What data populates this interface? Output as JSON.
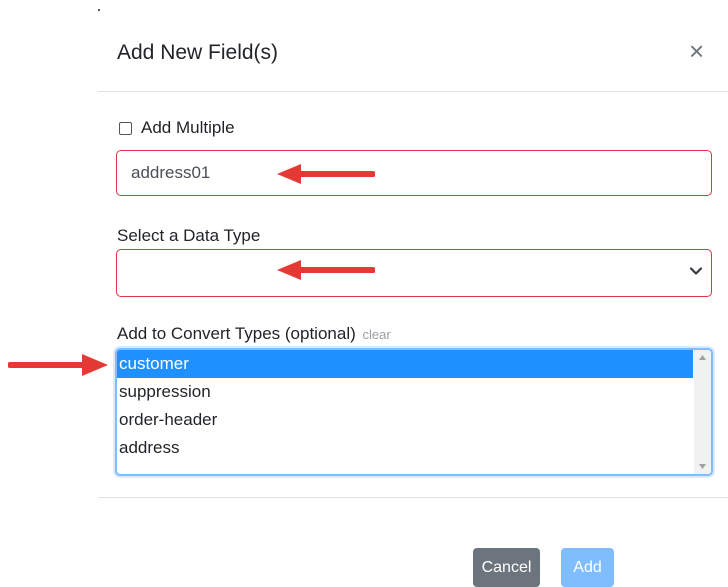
{
  "modal": {
    "title": "Add New Field(s)",
    "close_glyph": "×",
    "close_icon": "close-icon"
  },
  "add_multiple": {
    "label": "Add Multiple",
    "checked": false
  },
  "field_name": {
    "value": "address01"
  },
  "data_type": {
    "label": "Select a Data Type",
    "selected_value": "",
    "icon": "chevron-down-icon"
  },
  "convert_types": {
    "label": "Add to Convert Types (optional)",
    "clear_label": "clear",
    "options": [
      {
        "label": "customer",
        "selected": true
      },
      {
        "label": "suppression",
        "selected": false
      },
      {
        "label": "order-header",
        "selected": false
      },
      {
        "label": "address",
        "selected": false
      }
    ]
  },
  "footer": {
    "cancel_label": "Cancel",
    "add_label": "Add"
  },
  "colors": {
    "error_border": "#dc3545",
    "focus_border": "#80bdff",
    "selected_option": "#1e90ff",
    "cancel_button": "#6c757d",
    "add_button": "#80bdff",
    "annotation_arrow": "#e53935"
  },
  "annotations": {
    "arrow_icon": "red-arrow-icon"
  }
}
